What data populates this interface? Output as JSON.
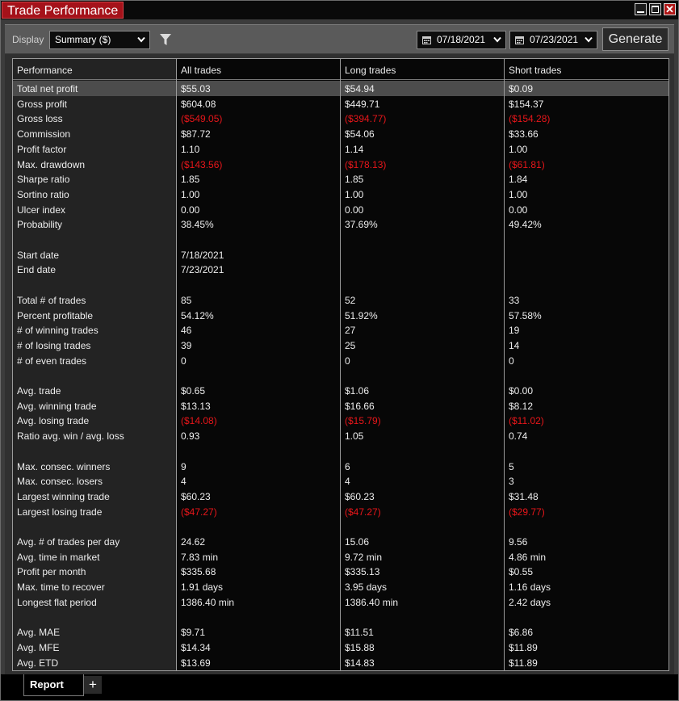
{
  "window": {
    "title": "Trade Performance"
  },
  "toolbar": {
    "display_label": "Display",
    "display_value": "Summary ($)",
    "start_date": "07/18/2021",
    "end_date": "07/23/2021",
    "generate_label": "Generate"
  },
  "table": {
    "headers": [
      "Performance",
      "All trades",
      "Long trades",
      "Short trades"
    ],
    "rows": [
      {
        "label": "Total net profit",
        "values": [
          "$55.03",
          "$54.94",
          "$0.09"
        ],
        "selected": true
      },
      {
        "label": "Gross profit",
        "values": [
          "$604.08",
          "$449.71",
          "$154.37"
        ]
      },
      {
        "label": "Gross loss",
        "values": [
          "($549.05)",
          "($394.77)",
          "($154.28)"
        ],
        "negative": true
      },
      {
        "label": "Commission",
        "values": [
          "$87.72",
          "$54.06",
          "$33.66"
        ]
      },
      {
        "label": "Profit factor",
        "values": [
          "1.10",
          "1.14",
          "1.00"
        ]
      },
      {
        "label": "Max. drawdown",
        "values": [
          "($143.56)",
          "($178.13)",
          "($61.81)"
        ],
        "negative": true
      },
      {
        "label": "Sharpe ratio",
        "values": [
          "1.85",
          "1.85",
          "1.84"
        ]
      },
      {
        "label": "Sortino ratio",
        "values": [
          "1.00",
          "1.00",
          "1.00"
        ]
      },
      {
        "label": "Ulcer index",
        "values": [
          "0.00",
          "0.00",
          "0.00"
        ]
      },
      {
        "label": "Probability",
        "values": [
          "38.45%",
          "37.69%",
          "49.42%"
        ]
      },
      {
        "spacer": true
      },
      {
        "label": "Start date",
        "values": [
          "7/18/2021",
          "",
          ""
        ]
      },
      {
        "label": "End date",
        "values": [
          "7/23/2021",
          "",
          ""
        ]
      },
      {
        "spacer": true
      },
      {
        "label": "Total # of trades",
        "values": [
          "85",
          "52",
          "33"
        ]
      },
      {
        "label": "Percent profitable",
        "values": [
          "54.12%",
          "51.92%",
          "57.58%"
        ]
      },
      {
        "label": "# of winning trades",
        "values": [
          "46",
          "27",
          "19"
        ]
      },
      {
        "label": "# of losing trades",
        "values": [
          "39",
          "25",
          "14"
        ]
      },
      {
        "label": "# of even trades",
        "values": [
          "0",
          "0",
          "0"
        ]
      },
      {
        "spacer": true
      },
      {
        "label": "Avg. trade",
        "values": [
          "$0.65",
          "$1.06",
          "$0.00"
        ]
      },
      {
        "label": "Avg. winning trade",
        "values": [
          "$13.13",
          "$16.66",
          "$8.12"
        ]
      },
      {
        "label": "Avg. losing trade",
        "values": [
          "($14.08)",
          "($15.79)",
          "($11.02)"
        ],
        "negative": true
      },
      {
        "label": "Ratio avg. win / avg. loss",
        "values": [
          "0.93",
          "1.05",
          "0.74"
        ]
      },
      {
        "spacer": true
      },
      {
        "label": "Max. consec. winners",
        "values": [
          "9",
          "6",
          "5"
        ]
      },
      {
        "label": "Max. consec. losers",
        "values": [
          "4",
          "4",
          "3"
        ]
      },
      {
        "label": "Largest winning trade",
        "values": [
          "$60.23",
          "$60.23",
          "$31.48"
        ]
      },
      {
        "label": "Largest losing trade",
        "values": [
          "($47.27)",
          "($47.27)",
          "($29.77)"
        ],
        "negative": true
      },
      {
        "spacer": true
      },
      {
        "label": "Avg. # of trades per day",
        "values": [
          "24.62",
          "15.06",
          "9.56"
        ]
      },
      {
        "label": "Avg. time in market",
        "values": [
          "7.83 min",
          "9.72 min",
          "4.86 min"
        ]
      },
      {
        "label": "Profit per month",
        "values": [
          "$335.68",
          "$335.13",
          "$0.55"
        ]
      },
      {
        "label": "Max. time to recover",
        "values": [
          "1.91 days",
          "3.95 days",
          "1.16 days"
        ]
      },
      {
        "label": "Longest flat period",
        "values": [
          "1386.40 min",
          "1386.40 min",
          "2.42 days"
        ]
      },
      {
        "spacer": true
      },
      {
        "label": "Avg. MAE",
        "values": [
          "$9.71",
          "$11.51",
          "$6.86"
        ]
      },
      {
        "label": "Avg. MFE",
        "values": [
          "$14.34",
          "$15.88",
          "$11.89"
        ]
      },
      {
        "label": "Avg. ETD",
        "values": [
          "$13.69",
          "$14.83",
          "$11.89"
        ]
      }
    ]
  },
  "tabs": {
    "report_label": "Report",
    "add_label": "+"
  },
  "colors": {
    "negative": "#e8161a",
    "title_tab": "#a5121a",
    "selected_row": "#4c4c4c"
  },
  "icons": [
    "minimize-icon",
    "maximize-icon",
    "close-icon",
    "chevron-down-icon",
    "filter-icon",
    "calendar-icon",
    "plus-icon"
  ]
}
